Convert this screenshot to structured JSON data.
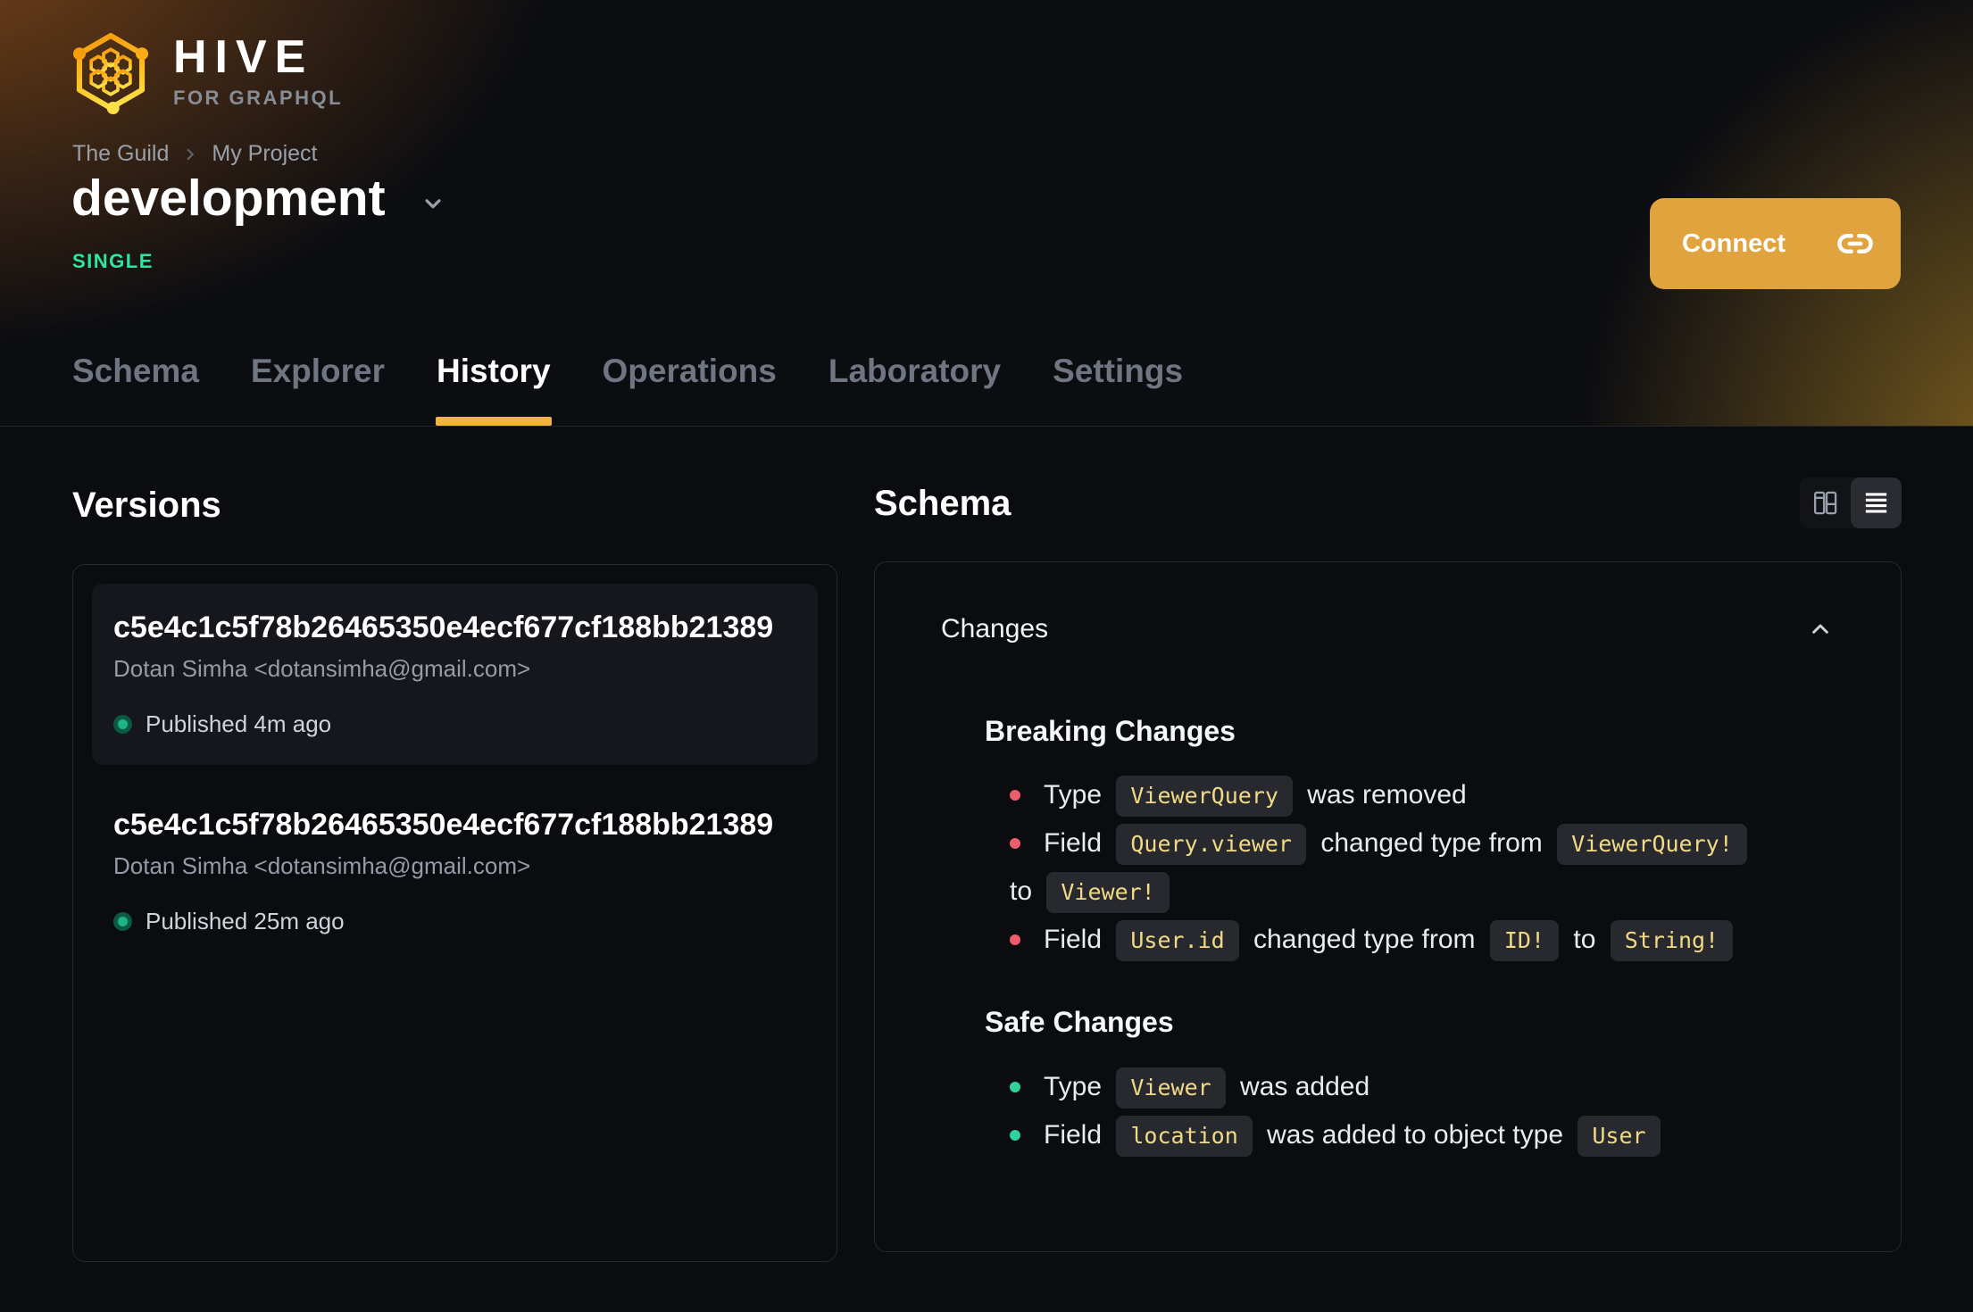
{
  "header": {
    "logo": {
      "title": "HIVE",
      "subtitle": "FOR GRAPHQL"
    },
    "breadcrumb": [
      "The Guild",
      "My Project"
    ],
    "target": {
      "name": "development",
      "badge": "SINGLE"
    },
    "connect_label": "Connect",
    "tabs": [
      {
        "label": "Schema",
        "active": false
      },
      {
        "label": "Explorer",
        "active": false
      },
      {
        "label": "History",
        "active": true
      },
      {
        "label": "Operations",
        "active": false
      },
      {
        "label": "Laboratory",
        "active": false
      },
      {
        "label": "Settings",
        "active": false
      }
    ]
  },
  "versions": {
    "heading": "Versions",
    "items": [
      {
        "hash": "c5e4c1c5f78b26465350e4ecf677cf188bb21389",
        "author": "Dotan Simha <dotansimha@gmail.com>",
        "status": "Published 4m ago",
        "selected": true
      },
      {
        "hash": "c5e4c1c5f78b26465350e4ecf677cf188bb21389",
        "author": "Dotan Simha <dotansimha@gmail.com>",
        "status": "Published 25m ago",
        "selected": false
      }
    ]
  },
  "schema": {
    "heading": "Schema",
    "view_toggle": {
      "options": [
        {
          "icon": "columns-icon",
          "selected": false
        },
        {
          "icon": "list-icon",
          "selected": true
        }
      ]
    },
    "changes": {
      "title": "Changes",
      "collapse_icon": "chevron-up-icon",
      "sections": [
        {
          "title": "Breaking Changes",
          "severity": "breaking",
          "items": [
            [
              {
                "t": "text",
                "v": "Type "
              },
              {
                "t": "code",
                "v": "ViewerQuery"
              },
              {
                "t": "text",
                "v": " was removed"
              }
            ],
            [
              {
                "t": "text",
                "v": "Field "
              },
              {
                "t": "code",
                "v": "Query.viewer"
              },
              {
                "t": "text",
                "v": " changed type from "
              },
              {
                "t": "code",
                "v": "ViewerQuery!"
              },
              {
                "t": "br"
              },
              {
                "t": "text",
                "v": "to "
              },
              {
                "t": "code",
                "v": "Viewer!"
              }
            ],
            [
              {
                "t": "text",
                "v": "Field "
              },
              {
                "t": "code",
                "v": "User.id"
              },
              {
                "t": "text",
                "v": " changed type from "
              },
              {
                "t": "code",
                "v": "ID!"
              },
              {
                "t": "text",
                "v": " to "
              },
              {
                "t": "code",
                "v": "String!"
              }
            ]
          ]
        },
        {
          "title": "Safe Changes",
          "severity": "safe",
          "items": [
            [
              {
                "t": "text",
                "v": "Type "
              },
              {
                "t": "code",
                "v": "Viewer"
              },
              {
                "t": "text",
                "v": " was added"
              }
            ],
            [
              {
                "t": "text",
                "v": "Field "
              },
              {
                "t": "code",
                "v": "location"
              },
              {
                "t": "text",
                "v": " was added to object type "
              },
              {
                "t": "code",
                "v": "User"
              }
            ]
          ]
        }
      ]
    }
  },
  "colors": {
    "amber": "#e1a33e",
    "amber_bright": "#f2b43e",
    "green_badge": "#2ee5a2",
    "green_bullet": "#2fd298",
    "red_bullet": "#ee5d6b",
    "chip_text": "#f1da85",
    "published_dot_inner": "#1db583",
    "published_dot_outer": "#0a5a41"
  }
}
